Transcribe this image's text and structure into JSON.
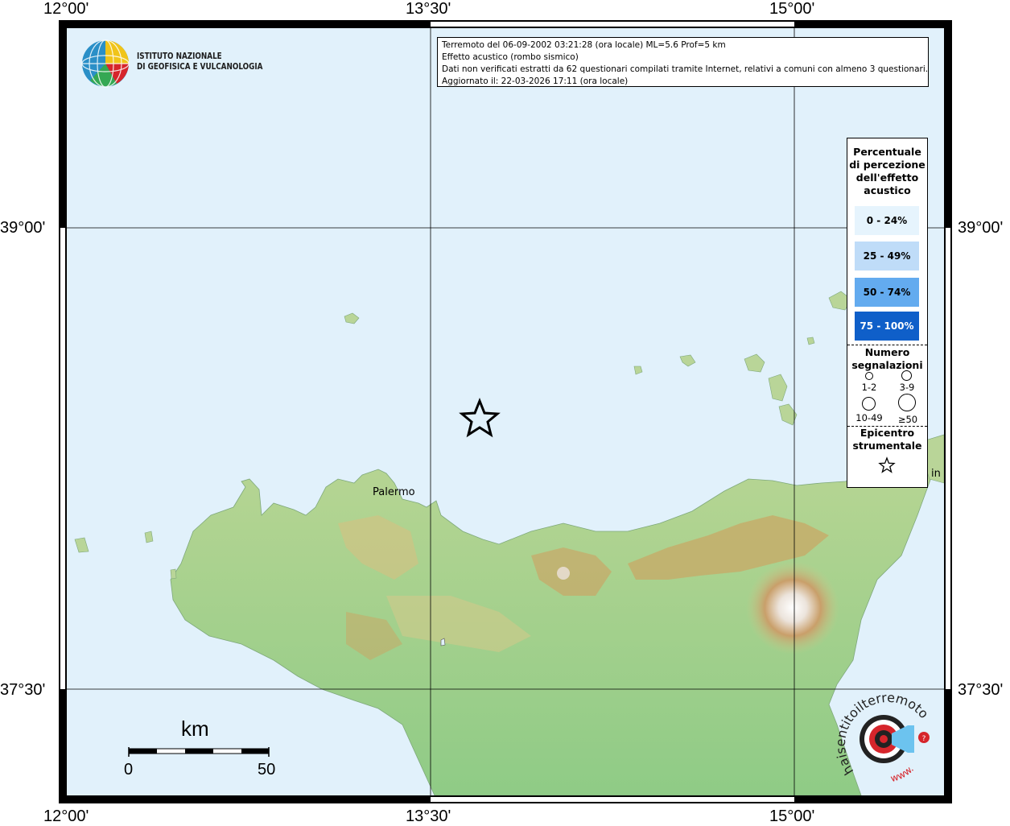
{
  "coordinates": {
    "lon_left": "12°00'",
    "lon_mid": "13°30'",
    "lon_right": "15°00'",
    "lat_upper": "39°00'",
    "lat_lower": "37°30'"
  },
  "logo": {
    "line1": "ISTITUTO NAZIONALE",
    "line2": "DI GEOFISICA E VULCANOLOGIA"
  },
  "info": {
    "line1": "Terremoto del 06-09-2002 03:21:28 (ora locale) ML=5.6 Prof=5 km",
    "line2": "Effetto acustico (rombo sismico)",
    "line3": "Dati non verificati estratti da 62 questionari compilati tramite Internet, relativi a comuni con almeno 3 questionari.",
    "line4": "Aggiornato il: 22-03-2026 17:11 (ora locale)"
  },
  "legend": {
    "title_line1": "Percentuale",
    "title_line2": "di percezione",
    "title_line3": "dell'effetto",
    "title_line4": "acustico",
    "classes": [
      {
        "label": "0 - 24%",
        "color": "#e6f4fd",
        "text_color": "#000000"
      },
      {
        "label": "25 - 49%",
        "color": "#bfdcf8",
        "text_color": "#000000"
      },
      {
        "label": "50 - 74%",
        "color": "#63abef",
        "text_color": "#000000"
      },
      {
        "label": "75 - 100%",
        "color": "#0f5fc9",
        "text_color": "#ffffff"
      }
    ],
    "count_title_line1": "Numero",
    "count_title_line2": "segnalazioni",
    "count_labels": [
      "1-2",
      "3-9",
      "10-49",
      "≥50"
    ],
    "epicenter_line1": "Epicentro",
    "epicenter_line2": "strumentale"
  },
  "places": {
    "palermo": "Palermo",
    "messina_fragment": "in"
  },
  "scale_bar": {
    "unit": "km",
    "start": "0",
    "end": "50"
  },
  "watermark": {
    "text_arc": "haisentitoilterremoto.it",
    "text_www": "www."
  },
  "colors": {
    "sea": "#e1f1fb",
    "land_low": "#9fcf8a",
    "land_mid": "#d9d08e",
    "land_high": "#b98c4a",
    "summit": "#f4f0ec"
  }
}
